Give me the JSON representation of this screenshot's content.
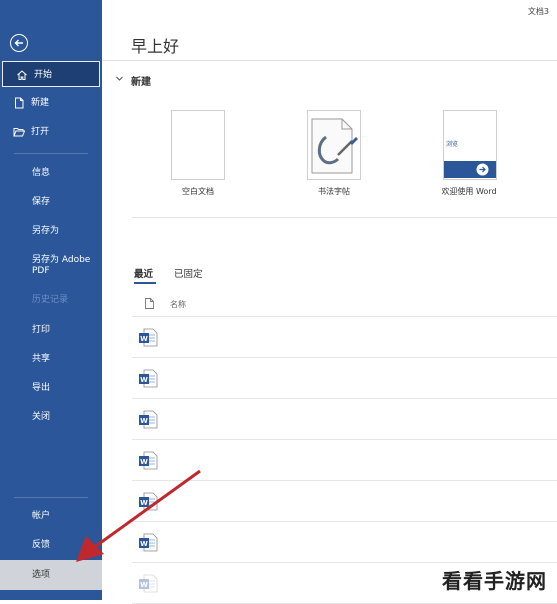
{
  "window": {
    "doc_title": "文档3"
  },
  "sidebar": {
    "items": [
      {
        "label": "开始"
      },
      {
        "label": "新建"
      },
      {
        "label": "打开"
      },
      {
        "label": "信息"
      },
      {
        "label": "保存"
      },
      {
        "label": "另存为"
      },
      {
        "label": "另存为 Adobe PDF"
      },
      {
        "label": "历史记录"
      },
      {
        "label": "打印"
      },
      {
        "label": "共享"
      },
      {
        "label": "导出"
      },
      {
        "label": "关闭"
      },
      {
        "label": "帐户"
      },
      {
        "label": "反馈"
      },
      {
        "label": "选项"
      }
    ]
  },
  "main": {
    "greeting": "早上好",
    "new_section": {
      "title": "新建",
      "templates": [
        {
          "label": "空白文档"
        },
        {
          "label": "书法字帖"
        },
        {
          "label": "欢迎使用 Word",
          "thumb_text": "浏览"
        }
      ]
    },
    "recent": {
      "tabs": [
        {
          "label": "最近"
        },
        {
          "label": "已固定"
        }
      ],
      "column_name": "名称",
      "row_count": 7
    }
  },
  "colors": {
    "sidebar": "#2b579a",
    "word_blue": "#2b579a",
    "arrow": "#c0282d"
  },
  "watermark": {
    "text": "看看手游网"
  }
}
